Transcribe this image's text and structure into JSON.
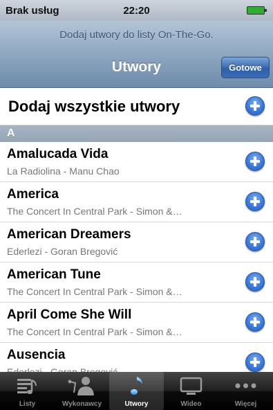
{
  "status_bar": {
    "carrier": "Brak usług",
    "time": "22:20"
  },
  "nav": {
    "prompt": "Dodaj utwory do listy On-The-Go.",
    "title": "Utwory",
    "done_label": "Gotowe"
  },
  "add_all_label": "Dodaj wszystkie utwory",
  "section_letter": "A",
  "songs": [
    {
      "title": "Amalucada Vida",
      "subtitle": "La Radiolina - Manu Chao"
    },
    {
      "title": "America",
      "subtitle": "The Concert In Central Park - Simon &…"
    },
    {
      "title": "American Dreamers",
      "subtitle": "Ederlezi - Goran Bregović"
    },
    {
      "title": "American Tune",
      "subtitle": "The Concert In Central Park - Simon &…"
    },
    {
      "title": "April Come She Will",
      "subtitle": "The Concert In Central Park - Simon &…"
    },
    {
      "title": "Ausencia",
      "subtitle": "Ederlezi - Goran Bregović"
    }
  ],
  "tabs": [
    {
      "label": "Listy",
      "icon": "playlist-icon"
    },
    {
      "label": "Wykonawcy",
      "icon": "artists-icon"
    },
    {
      "label": "Utwory",
      "icon": "music-note-icon",
      "active": true
    },
    {
      "label": "Wideo",
      "icon": "video-icon"
    },
    {
      "label": "Więcej",
      "icon": "more-icon"
    }
  ],
  "colors": {
    "accent": "#3c78d8",
    "nav_top": "#b4c4d6",
    "nav_bottom": "#6f8cac"
  }
}
